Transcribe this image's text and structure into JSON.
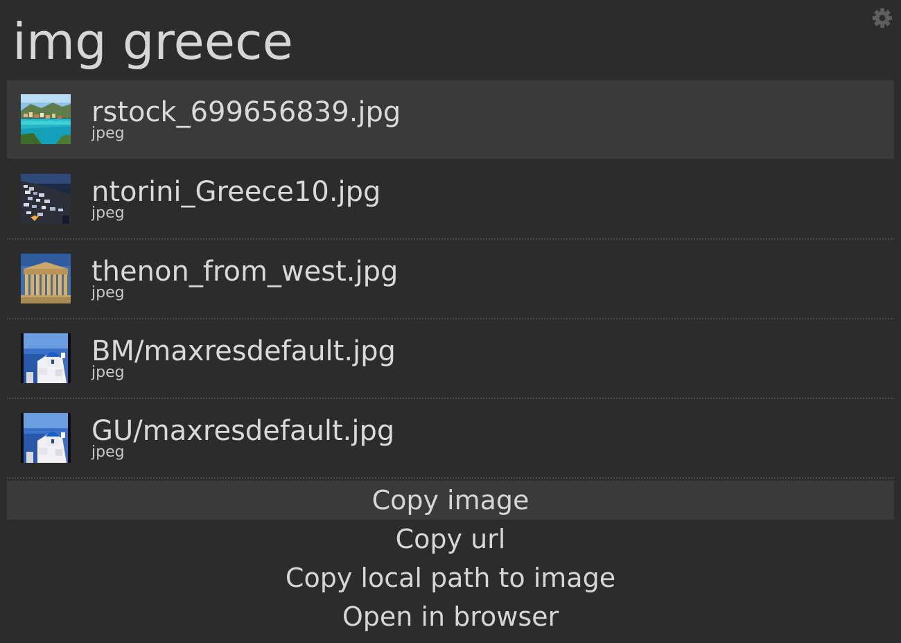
{
  "search": {
    "query": "img greece"
  },
  "header": {
    "settings_icon": "gear-icon"
  },
  "results": [
    {
      "title": "rstock_699656839.jpg",
      "subtitle": "jpeg",
      "thumbnail": "coastal-village-thumbnail",
      "selected": true
    },
    {
      "title": "ntorini_Greece10.jpg",
      "subtitle": "jpeg",
      "thumbnail": "santorini-night-thumbnail",
      "selected": false
    },
    {
      "title": "thenon_from_west.jpg",
      "subtitle": "jpeg",
      "thumbnail": "parthenon-thumbnail",
      "selected": false
    },
    {
      "title": "BM/maxresdefault.jpg",
      "subtitle": "jpeg",
      "thumbnail": "blue-dome-thumbnail",
      "selected": false
    },
    {
      "title": "GU/maxresdefault.jpg",
      "subtitle": "jpeg",
      "thumbnail": "blue-dome-thumbnail",
      "selected": false
    }
  ],
  "actions": [
    {
      "label": "Copy image",
      "selected": true
    },
    {
      "label": "Copy url",
      "selected": false
    },
    {
      "label": "Copy local path to image",
      "selected": false
    },
    {
      "label": "Open in browser",
      "selected": false
    }
  ],
  "colors": {
    "background": "#2c2c2c",
    "selected_row": "#3a3a3a",
    "text": "#d6d6d6",
    "separator": "#4a4a4a"
  }
}
